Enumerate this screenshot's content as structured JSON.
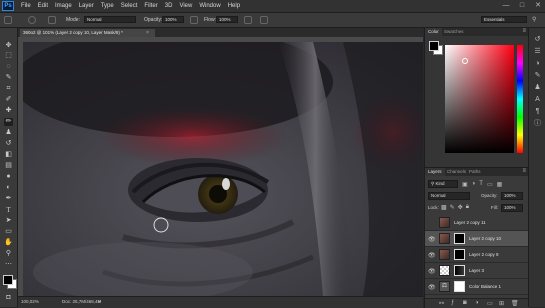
{
  "app": {
    "logo": "Ps"
  },
  "menu": [
    "File",
    "Edit",
    "Image",
    "Layer",
    "Type",
    "Select",
    "Filter",
    "3D",
    "View",
    "Window",
    "Help"
  ],
  "window_controls": {
    "minimize": "—",
    "maximize": "□",
    "close": "✕"
  },
  "options_bar": {
    "mode_label": "Mode:",
    "mode_value": "Normal",
    "opacity_label": "Opacity:",
    "opacity_value": "100%",
    "flow_label": "Flow:",
    "flow_value": "100%",
    "workspace": "Essentials"
  },
  "document": {
    "tab_title": "360o2 @ 101% (Layer 2 copy 10, Layer Mask/8) *",
    "close": "×"
  },
  "status": {
    "zoom": "100,02%",
    "doc_info": "Doc: 25,7M/468,4M"
  },
  "color_panel": {
    "tabs": [
      "Color",
      "Swatches"
    ],
    "foreground": "#000000",
    "background": "#ffffff",
    "hue": "#ff0014"
  },
  "layers_panel": {
    "tabs": [
      "Layers",
      "Channels",
      "Paths"
    ],
    "filter_kind": "Kind",
    "blend_mode": "Normal",
    "opacity_label": "Opacity:",
    "opacity_value": "100%",
    "lock_label": "Lock:",
    "fill_label": "Fill:",
    "fill_value": "100%",
    "layers": [
      {
        "name": "Layer 2 copy 11",
        "visible": false,
        "selected": false,
        "has_mask": false,
        "thumb": "face"
      },
      {
        "name": "Layer 2 copy 10",
        "visible": true,
        "selected": true,
        "has_mask": true,
        "thumb": "face"
      },
      {
        "name": "Layer 2 copy 9",
        "visible": true,
        "selected": false,
        "has_mask": true,
        "thumb": "face"
      },
      {
        "name": "Layer 3",
        "visible": true,
        "selected": false,
        "has_mask": false,
        "thumb": "checker"
      },
      {
        "name": "Color Balance 1",
        "visible": true,
        "selected": false,
        "has_mask": true,
        "thumb": "adjust"
      }
    ]
  }
}
